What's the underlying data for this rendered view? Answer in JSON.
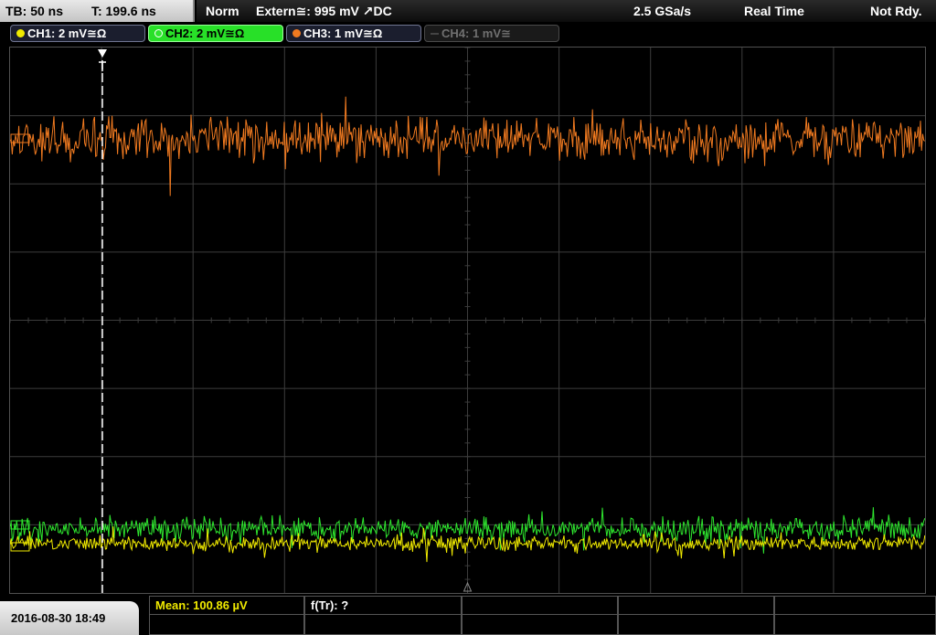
{
  "header": {
    "timebase": "TB: 50 ns",
    "trigger_time": "T: 199.6 ns",
    "mode": "Norm",
    "trigger_source": "Extern≅: 995 mV ↗DC",
    "sample_rate": "2.5 GSa/s",
    "acquisition": "Real Time",
    "status": "Not Rdy."
  },
  "channels": [
    {
      "label": "CH1: 2 mV≅Ω",
      "color": "#f0ea00",
      "active": false,
      "enabled": true
    },
    {
      "label": "CH2: 2 mV≅Ω",
      "color": "#2ee62e",
      "active": true,
      "enabled": true
    },
    {
      "label": "CH3: 1 mV≅Ω",
      "color": "#f07a20",
      "active": false,
      "enabled": true
    },
    {
      "label": "CH4: 1 mV≅",
      "color": "#5a5a5a",
      "active": false,
      "enabled": false
    }
  ],
  "colors": {
    "grid": "#3c3c3c",
    "ch1_trace": "#f0ea00",
    "ch2_trace": "#2ee62e",
    "ch3_trace": "#f07a20",
    "trigger_marker": "#ffffff"
  },
  "footer": {
    "datetime": "2016-08-30 18:49",
    "measurements": [
      {
        "text": "Mean: 100.86 µV"
      },
      {
        "text": "f(Tr): ?"
      },
      {
        "text": ""
      },
      {
        "text": ""
      },
      {
        "text": ""
      }
    ]
  },
  "icons": {
    "trigger_marker": "trigger-position-icon",
    "channel_dot": "channel-indicator-icon",
    "center_marker": "center-triangle-icon"
  }
}
